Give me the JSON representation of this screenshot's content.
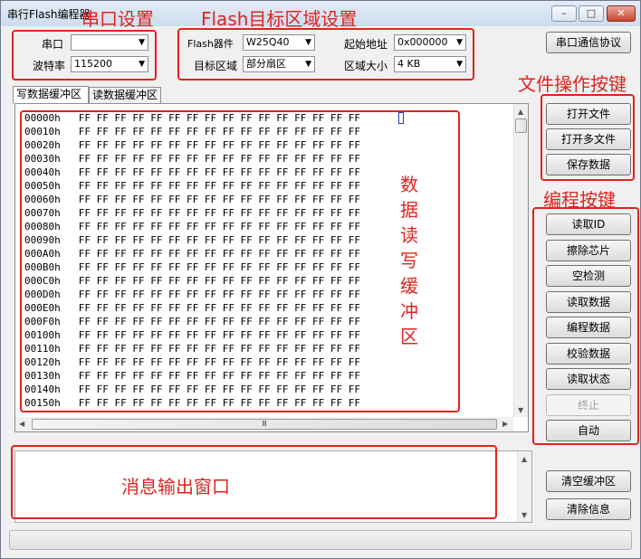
{
  "window": {
    "title": "串行Flash编程器"
  },
  "window_controls": {
    "minimize": "–",
    "maximize": "□",
    "close": "✕"
  },
  "serial": {
    "port_label": "串口",
    "port_value": "",
    "baud_label": "波特率",
    "baud_value": "115200"
  },
  "flash": {
    "device_label": "Flash器件",
    "device_value": "W25Q40",
    "region_label": "目标区域",
    "region_value": "部分扇区",
    "start_label": "起始地址",
    "start_value": "0x000000",
    "size_label": "区域大小",
    "size_value": "4 KB"
  },
  "protocol_button": "串口通信协议",
  "tabs": [
    "写数据缓冲区",
    "读数据缓冲区"
  ],
  "hex_rows": [
    {
      "addr": "00000h",
      "bytes": "FF FF FF FF FF FF FF FF FF FF FF FF FF FF FF FF"
    },
    {
      "addr": "00010h",
      "bytes": "FF FF FF FF FF FF FF FF FF FF FF FF FF FF FF FF"
    },
    {
      "addr": "00020h",
      "bytes": "FF FF FF FF FF FF FF FF FF FF FF FF FF FF FF FF"
    },
    {
      "addr": "00030h",
      "bytes": "FF FF FF FF FF FF FF FF FF FF FF FF FF FF FF FF"
    },
    {
      "addr": "00040h",
      "bytes": "FF FF FF FF FF FF FF FF FF FF FF FF FF FF FF FF"
    },
    {
      "addr": "00050h",
      "bytes": "FF FF FF FF FF FF FF FF FF FF FF FF FF FF FF FF"
    },
    {
      "addr": "00060h",
      "bytes": "FF FF FF FF FF FF FF FF FF FF FF FF FF FF FF FF"
    },
    {
      "addr": "00070h",
      "bytes": "FF FF FF FF FF FF FF FF FF FF FF FF FF FF FF FF"
    },
    {
      "addr": "00080h",
      "bytes": "FF FF FF FF FF FF FF FF FF FF FF FF FF FF FF FF"
    },
    {
      "addr": "00090h",
      "bytes": "FF FF FF FF FF FF FF FF FF FF FF FF FF FF FF FF"
    },
    {
      "addr": "000A0h",
      "bytes": "FF FF FF FF FF FF FF FF FF FF FF FF FF FF FF FF"
    },
    {
      "addr": "000B0h",
      "bytes": "FF FF FF FF FF FF FF FF FF FF FF FF FF FF FF FF"
    },
    {
      "addr": "000C0h",
      "bytes": "FF FF FF FF FF FF FF FF FF FF FF FF FF FF FF FF"
    },
    {
      "addr": "000D0h",
      "bytes": "FF FF FF FF FF FF FF FF FF FF FF FF FF FF FF FF"
    },
    {
      "addr": "000E0h",
      "bytes": "FF FF FF FF FF FF FF FF FF FF FF FF FF FF FF FF"
    },
    {
      "addr": "000F0h",
      "bytes": "FF FF FF FF FF FF FF FF FF FF FF FF FF FF FF FF"
    },
    {
      "addr": "00100h",
      "bytes": "FF FF FF FF FF FF FF FF FF FF FF FF FF FF FF FF"
    },
    {
      "addr": "00110h",
      "bytes": "FF FF FF FF FF FF FF FF FF FF FF FF FF FF FF FF"
    },
    {
      "addr": "00120h",
      "bytes": "FF FF FF FF FF FF FF FF FF FF FF FF FF FF FF FF"
    },
    {
      "addr": "00130h",
      "bytes": "FF FF FF FF FF FF FF FF FF FF FF FF FF FF FF FF"
    },
    {
      "addr": "00140h",
      "bytes": "FF FF FF FF FF FF FF FF FF FF FF FF FF FF FF FF"
    },
    {
      "addr": "00150h",
      "bytes": "FF FF FF FF FF FF FF FF FF FF FF FF FF FF FF FF"
    }
  ],
  "file_buttons": {
    "open": "打开文件",
    "open_multi": "打开多文件",
    "save": "保存数据"
  },
  "prog_buttons": {
    "read_id": "读取ID",
    "erase": "擦除芯片",
    "blank": "空检测",
    "read": "读取数据",
    "program": "编程数据",
    "verify": "校验数据",
    "status": "读取状态",
    "stop": "终止",
    "auto": "自动"
  },
  "msg_buttons": {
    "clear_buffer": "清空缓冲区",
    "clear_info": "清除信息"
  },
  "annotations": {
    "serial": "串口设置",
    "flash": "Flash目标区域设置",
    "file_ops": "文件操作按键",
    "prog": "编程按键",
    "buffer": "数据读写缓冲区",
    "msg": "消息输出窗口"
  },
  "scroll_icons": {
    "up": "▲",
    "down": "▼",
    "left": "◀",
    "right": "▶",
    "grip": "Ⅲ"
  },
  "colors": {
    "annotation_red": "#e0231f"
  }
}
